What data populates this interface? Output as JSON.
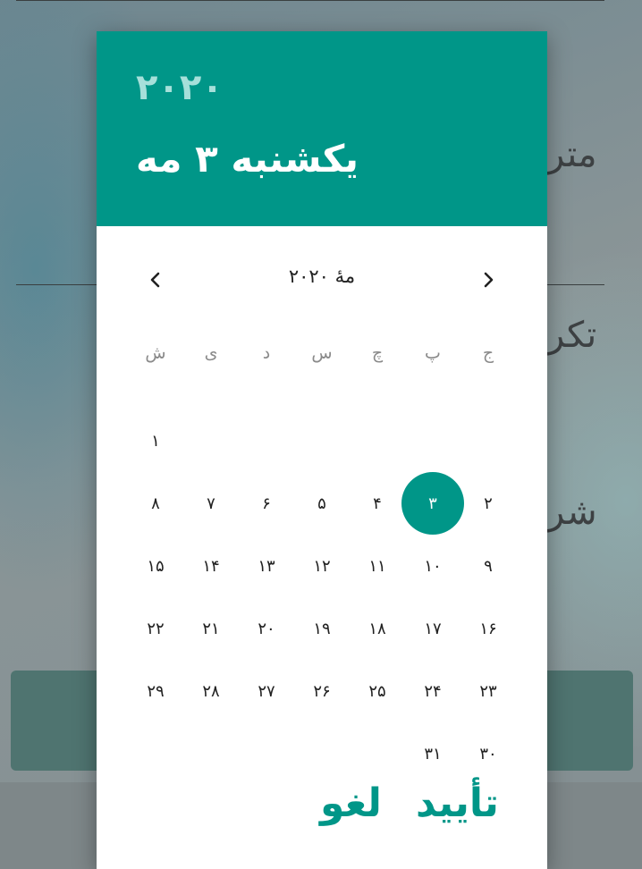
{
  "background": {
    "label_1": "متر",
    "label_2": "تکر",
    "label_3": "شر"
  },
  "dialog": {
    "header": {
      "year": "۲۰۲۰",
      "selected_date": "یکشنبه ۳ مه"
    },
    "calendar": {
      "month_label": "مهٔ ۲۰۲۰",
      "weekdays": [
        "ش",
        "ی",
        "د",
        "س",
        "چ",
        "پ",
        "ج"
      ],
      "leading_blanks": 6,
      "days": [
        "۱",
        "۲",
        "۳",
        "۴",
        "۵",
        "۶",
        "۷",
        "۸",
        "۹",
        "۱۰",
        "۱۱",
        "۱۲",
        "۱۳",
        "۱۴",
        "۱۵",
        "۱۶",
        "۱۷",
        "۱۸",
        "۱۹",
        "۲۰",
        "۲۱",
        "۲۲",
        "۲۳",
        "۲۴",
        "۲۵",
        "۲۶",
        "۲۷",
        "۲۸",
        "۲۹",
        "۳۰",
        "۳۱"
      ],
      "selected_day": "۳"
    },
    "actions": {
      "ok_label": "تأیید",
      "cancel_label": "لغو"
    }
  },
  "colors": {
    "accent": "#009688",
    "year_text": "#a6e0da"
  },
  "icons": {
    "prev": "chevron-left-icon",
    "next": "chevron-right-icon"
  }
}
